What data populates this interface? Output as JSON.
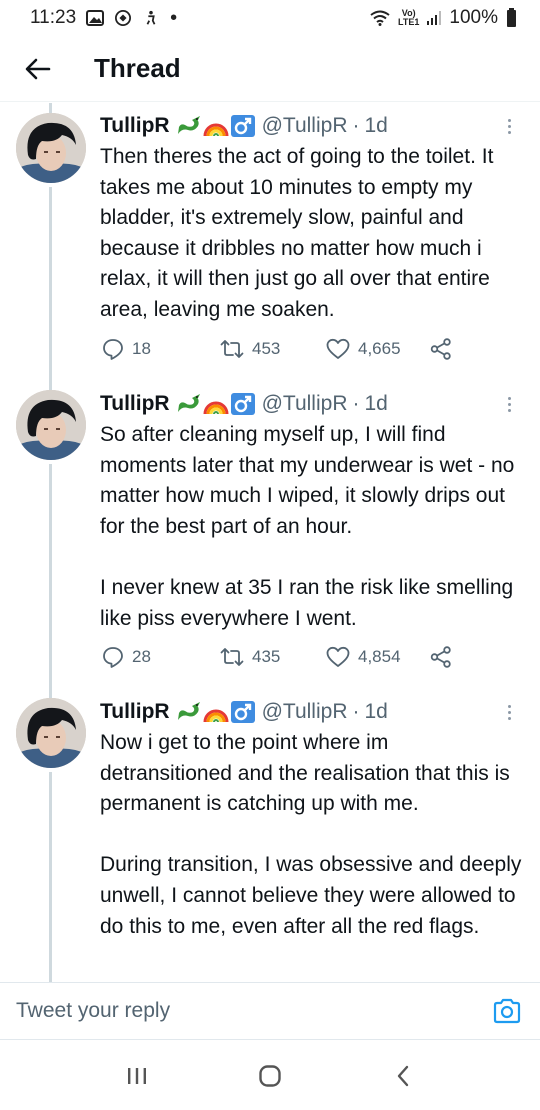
{
  "status_bar": {
    "time": "11:23",
    "network_label": "Vo)\nLTE1",
    "battery": "100%"
  },
  "header": {
    "title": "Thread"
  },
  "tweets": [
    {
      "name": "TullipR",
      "emojis": [
        "dragon-emoji",
        "rainbow-emoji",
        "male-sign-emoji"
      ],
      "handle": "@TullipR",
      "separator": "·",
      "time": "1d",
      "text": "Then theres the act of going to the toilet. It takes me about 10 minutes to empty my bladder, it's extremely slow, painful and because it dribbles no matter how much i relax, it will then just go all over that entire area, leaving me soaken.",
      "replies": "18",
      "retweets": "453",
      "likes": "4,665"
    },
    {
      "name": "TullipR",
      "emojis": [
        "dragon-emoji",
        "rainbow-emoji",
        "male-sign-emoji"
      ],
      "handle": "@TullipR",
      "separator": "·",
      "time": "1d",
      "text": "So after cleaning myself up, I will find moments later that my underwear is wet - no matter how much I wiped, it slowly drips out for the best part of an hour.\n\nI never knew at 35 I ran the risk like smelling like piss everywhere I went.",
      "replies": "28",
      "retweets": "435",
      "likes": "4,854"
    },
    {
      "name": "TullipR",
      "emojis": [
        "dragon-emoji",
        "rainbow-emoji",
        "male-sign-emoji"
      ],
      "handle": "@TullipR",
      "separator": "·",
      "time": "1d",
      "text": "Now i get to the point where im detransitioned and the realisation that this is permanent is catching up with me.\n\nDuring transition, I was obsessive and deeply unwell, I cannot believe they were allowed to do this to me, even after all the red flags."
    }
  ],
  "reply_bar": {
    "placeholder": "Tweet your reply"
  },
  "colors": {
    "accent": "#1d9bf0",
    "text": "#0f1419",
    "secondary": "#536471",
    "rail": "#cfd9de"
  }
}
